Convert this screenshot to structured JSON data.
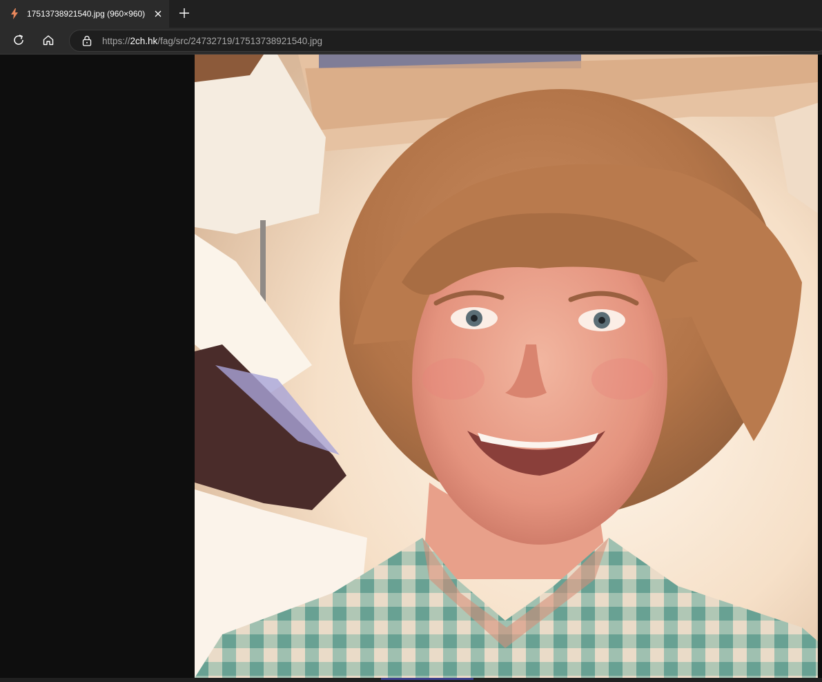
{
  "browser": {
    "tab": {
      "title": "17513738921540.jpg (960×960)",
      "favicon": "lightning-bolt-icon",
      "favicon_color": "#e8875b"
    },
    "address": {
      "scheme": "https://",
      "host": "2ch.hk",
      "path": "/fag/src/24732719/17513738921540.jpg"
    },
    "icons": {
      "reload": "reload-icon",
      "home": "home-icon",
      "lock": "lock-icon",
      "close": "close-icon",
      "new_tab": "plus-icon"
    }
  },
  "image": {
    "description_hidden": null,
    "background_color": "#0e0e0e"
  }
}
